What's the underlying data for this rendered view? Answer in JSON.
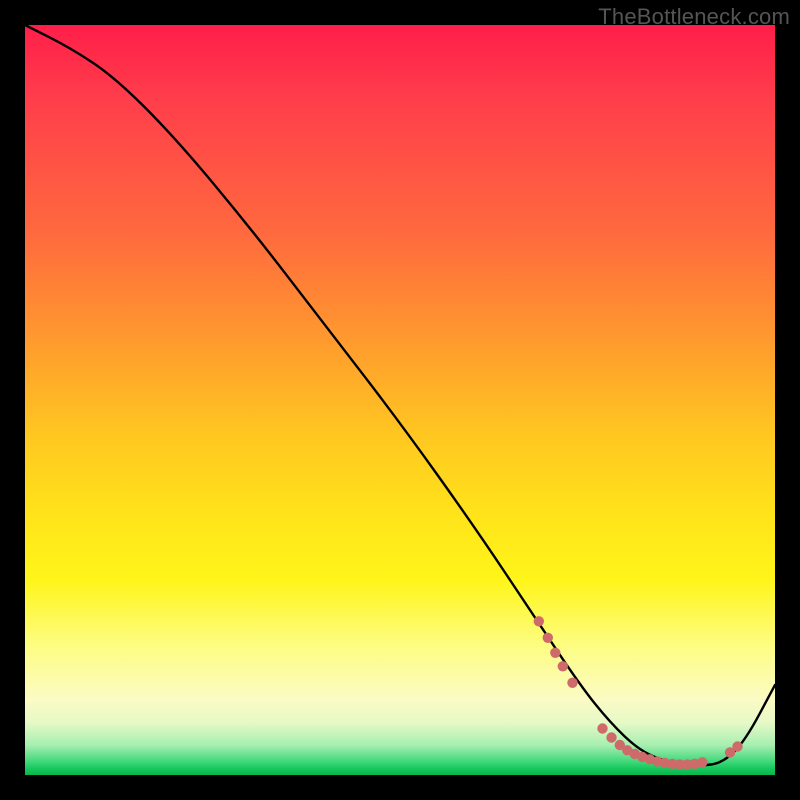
{
  "watermark_text": "TheBottleneck.com",
  "colors": {
    "background": "#000000",
    "curve": "#000000",
    "dots": "#cf6a6a",
    "gradient_top": "#ff1e4a",
    "gradient_bottom": "#06b84a"
  },
  "chart_data": {
    "type": "line",
    "title": "",
    "xlabel": "",
    "ylabel": "",
    "xlim": [
      0,
      100
    ],
    "ylim": [
      0,
      100
    ],
    "series": [
      {
        "name": "curve",
        "x": [
          0,
          6,
          12,
          20,
          30,
          40,
          50,
          60,
          68,
          74,
          78,
          82,
          86,
          90,
          93,
          96,
          100
        ],
        "y": [
          100,
          97,
          93,
          85,
          73,
          60,
          47,
          33,
          21,
          12,
          7,
          3.2,
          1.6,
          1.2,
          1.6,
          4.5,
          12
        ]
      }
    ],
    "markers": [
      {
        "x": 68.5,
        "y": 20.5
      },
      {
        "x": 69.7,
        "y": 18.3
      },
      {
        "x": 70.7,
        "y": 16.3
      },
      {
        "x": 71.7,
        "y": 14.5
      },
      {
        "x": 73.0,
        "y": 12.3
      },
      {
        "x": 77.0,
        "y": 6.2
      },
      {
        "x": 78.2,
        "y": 5.0
      },
      {
        "x": 79.3,
        "y": 4.0
      },
      {
        "x": 80.3,
        "y": 3.3
      },
      {
        "x": 81.3,
        "y": 2.8
      },
      {
        "x": 82.3,
        "y": 2.4
      },
      {
        "x": 83.3,
        "y": 2.1
      },
      {
        "x": 84.3,
        "y": 1.8
      },
      {
        "x": 85.3,
        "y": 1.6
      },
      {
        "x": 86.3,
        "y": 1.5
      },
      {
        "x": 87.3,
        "y": 1.4
      },
      {
        "x": 88.3,
        "y": 1.4
      },
      {
        "x": 89.3,
        "y": 1.5
      },
      {
        "x": 90.3,
        "y": 1.7
      },
      {
        "x": 94.0,
        "y": 3.0
      },
      {
        "x": 95.0,
        "y": 3.8
      }
    ],
    "annotations": []
  }
}
